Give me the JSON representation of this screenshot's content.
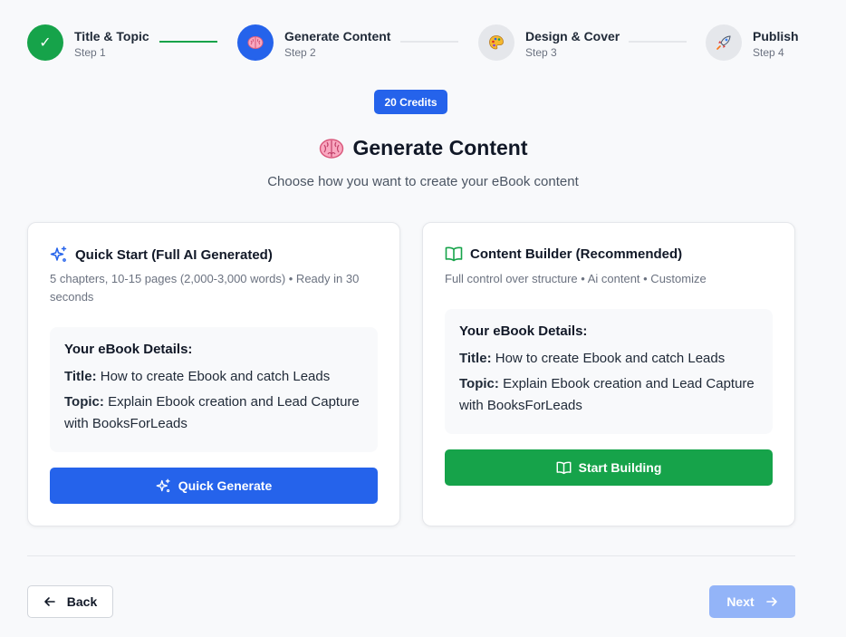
{
  "stepper": {
    "steps": [
      {
        "title": "Title & Topic",
        "sub": "Step 1",
        "state": "complete",
        "icon": "check-icon"
      },
      {
        "title": "Generate Content",
        "sub": "Step 2",
        "state": "current",
        "icon": "brain-icon"
      },
      {
        "title": "Design & Cover",
        "sub": "Step 3",
        "state": "upcoming",
        "icon": "palette-icon"
      },
      {
        "title": "Publish",
        "sub": "Step 4",
        "state": "upcoming",
        "icon": "rocket-icon"
      }
    ],
    "check_glyph": "✓",
    "colors": {
      "complete": "#16a34a",
      "current": "#2563eb",
      "upcoming": "#e5e7eb"
    }
  },
  "credits": "20 Credits",
  "page": {
    "title": "Generate Content",
    "subtitle": "Choose how you want to create your eBook content"
  },
  "quick_start": {
    "title": "Quick Start (Full AI Generated)",
    "description": "5 chapters, 10-15 pages (2,000-3,000 words) • Ready in 30 seconds",
    "details_heading": "Your eBook Details:",
    "title_label": "Title:",
    "title_value": "How to create Ebook and catch Leads",
    "topic_label": "Topic:",
    "topic_value": "Explain Ebook creation and Lead Capture with BooksForLeads",
    "button_label": "Quick Generate",
    "button_color": "#2563eb",
    "icon": "sparkles-icon"
  },
  "content_builder": {
    "title": "Content Builder (Recommended)",
    "description": "Full control over structure • Ai content • Customize",
    "details_heading": "Your eBook Details:",
    "title_label": "Title:",
    "title_value": "How to create Ebook and catch Leads",
    "topic_label": "Topic:",
    "topic_value": "Explain Ebook creation and Lead Capture with BooksForLeads",
    "button_label": "Start Building",
    "button_color": "#16a34a",
    "icon": "book-open-icon"
  },
  "footer": {
    "back_label": "Back",
    "next_label": "Next"
  }
}
